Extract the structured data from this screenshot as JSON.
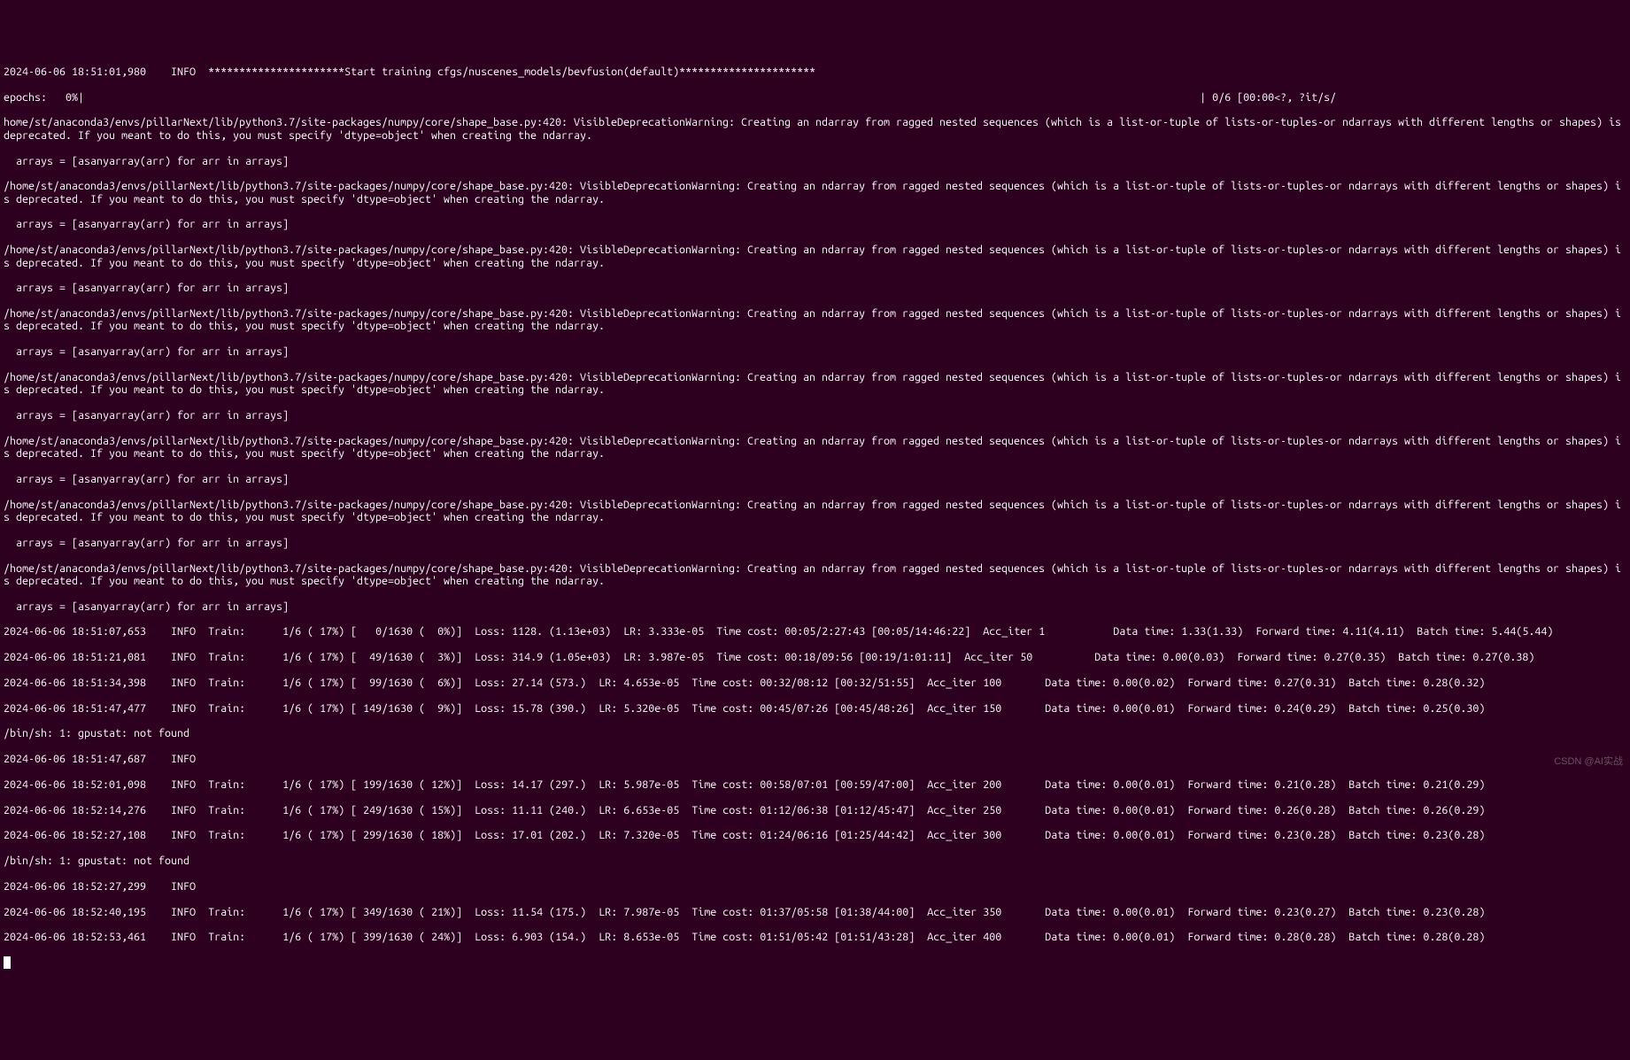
{
  "header": {
    "timestamp": "2024-06-06 18:51:01,980",
    "level": "INFO",
    "separator_left": "**********************",
    "message": "Start training cfgs/nuscenes_models/bevfusion(default)",
    "separator_right": "**********************"
  },
  "epochs_line": {
    "label": "epochs:",
    "percent": "0%",
    "progress_bar": "|",
    "counter": "| 0/6 [00:00<?, ?it/s/"
  },
  "warning_path": "home/st/anaconda3/envs/pillarNext/lib/python3.7/site-packages/numpy/core/shape_base.py:420: VisibleDeprecationWarning: Creating an ndarray from ragged nested sequences (which is a list-or-tuple of lists-or-tuples-or ndarrays with different lengths or shapes) is deprecated. If you meant to do this, you must specify 'dtype=object' when creating the ndarray.",
  "warning_path_slash": "/home/st/anaconda3/envs/pillarNext/lib/python3.7/site-packages/numpy/core/shape_base.py:420: VisibleDeprecationWarning: Creating an ndarray from ragged nested sequences (which is a list-or-tuple of lists-or-tuples-or ndarrays with different lengths or shapes) is deprecated. If you meant to do this, you must specify 'dtype=object' when creating the ndarray.",
  "arrays_line": "  arrays = [asanyarray(arr) for arr in arrays]",
  "gpustat_error": "/bin/sh: 1: gpustat: not found",
  "train_lines": [
    {
      "ts": "2024-06-06 18:51:07,653",
      "level": "INFO",
      "label": "Train:",
      "epoch": "1/6 ( 17%)",
      "iter": "[   0/1630 (  0%)]",
      "loss": "Loss: 1128. (1.13e+03)",
      "lr": "LR: 3.333e-05",
      "time_cost": "Time cost: 00:05/2:27:43 [00:05/14:46:22]",
      "acc": "Acc_iter 1",
      "data_time": "Data time: 1.33(1.33)",
      "fwd": "Forward time: 4.11(4.11)  Batch time: 5.44(5.44)",
      "wrap": true
    },
    {
      "ts": "2024-06-06 18:51:21,081",
      "level": "INFO",
      "label": "Train:",
      "epoch": "1/6 ( 17%)",
      "iter": "[  49/1630 (  3%)]",
      "loss": "Loss: 314.9 (1.05e+03)",
      "lr": "LR: 3.987e-05",
      "time_cost": "Time cost: 00:18/09:56 [00:19/1:01:11]",
      "acc": "Acc_iter 50",
      "data_time": "Data time: 0.00(0.03)",
      "fwd": "Forward time: 0.27(0.35)  Batch time: 0.27(0.38)",
      "wrap": true
    },
    {
      "ts": "2024-06-06 18:51:34,398",
      "level": "INFO",
      "label": "Train:",
      "epoch": "1/6 ( 17%)",
      "iter": "[  99/1630 (  6%)]",
      "loss": "Loss: 27.14 (573.)",
      "lr": "LR: 4.653e-05",
      "time_cost": "Time cost: 00:32/08:12 [00:32/51:55]",
      "acc": "Acc_iter 100",
      "data_time": "Data time: 0.00(0.02)",
      "fwd": "Forward time: 0.27(0.31)  Batch time: 0.28(0.32)",
      "wrap": true
    },
    {
      "ts": "2024-06-06 18:51:47,477",
      "level": "INFO",
      "label": "Train:",
      "epoch": "1/6 ( 17%)",
      "iter": "[ 149/1630 (  9%)]",
      "loss": "Loss: 15.78 (390.)",
      "lr": "LR: 5.320e-05",
      "time_cost": "Time cost: 00:45/07:26 [00:45/48:26]",
      "acc": "Acc_iter 150",
      "data_time": "Data time: 0.00(0.01)",
      "fwd": "Forward time: 0.24(0.29)  Batch time: 0.25(0.30)",
      "wrap": true
    }
  ],
  "info_empty": [
    {
      "ts": "2024-06-06 18:51:47,687",
      "level": "INFO"
    },
    {
      "ts": "2024-06-06 18:52:27,299",
      "level": "INFO"
    }
  ],
  "train_lines_2": [
    {
      "ts": "2024-06-06 18:52:01,098",
      "level": "INFO",
      "label": "Train:",
      "epoch": "1/6 ( 17%)",
      "iter": "[ 199/1630 ( 12%)]",
      "loss": "Loss: 14.17 (297.)",
      "lr": "LR: 5.987e-05",
      "time_cost": "Time cost: 00:58/07:01 [00:59/47:00]",
      "acc": "Acc_iter 200",
      "data_time": "Data time: 0.00(0.01)",
      "fwd": "Forward time: 0.21(0.28)  Batch time: 0.21(0.29)"
    },
    {
      "ts": "2024-06-06 18:52:14,276",
      "level": "INFO",
      "label": "Train:",
      "epoch": "1/6 ( 17%)",
      "iter": "[ 249/1630 ( 15%)]",
      "loss": "Loss: 11.11 (240.)",
      "lr": "LR: 6.653e-05",
      "time_cost": "Time cost: 01:12/06:38 [01:12/45:47]",
      "acc": "Acc_iter 250",
      "data_time": "Data time: 0.00(0.01)",
      "fwd": "Forward time: 0.26(0.28)  Batch time: 0.26(0.29)"
    },
    {
      "ts": "2024-06-06 18:52:27,108",
      "level": "INFO",
      "label": "Train:",
      "epoch": "1/6 ( 17%)",
      "iter": "[ 299/1630 ( 18%)]",
      "loss": "Loss: 17.01 (202.)",
      "lr": "LR: 7.320e-05",
      "time_cost": "Time cost: 01:24/06:16 [01:25/44:42]",
      "acc": "Acc_iter 300",
      "data_time": "Data time: 0.00(0.01)",
      "fwd": "Forward time: 0.23(0.28)  Batch time: 0.23(0.28)"
    }
  ],
  "train_lines_3": [
    {
      "ts": "2024-06-06 18:52:40,195",
      "level": "INFO",
      "label": "Train:",
      "epoch": "1/6 ( 17%)",
      "iter": "[ 349/1630 ( 21%)]",
      "loss": "Loss: 11.54 (175.)",
      "lr": "LR: 7.987e-05",
      "time_cost": "Time cost: 01:37/05:58 [01:38/44:00]",
      "acc": "Acc_iter 350",
      "data_time": "Data time: 0.00(0.01)",
      "fwd": "Forward time: 0.23(0.27)  Batch time: 0.23(0.28)"
    },
    {
      "ts": "2024-06-06 18:52:53,461",
      "level": "INFO",
      "label": "Train:",
      "epoch": "1/6 ( 17%)",
      "iter": "[ 399/1630 ( 24%)]",
      "loss": "Loss: 6.903 (154.)",
      "lr": "LR: 8.653e-05",
      "time_cost": "Time cost: 01:51/05:42 [01:51/43:28]",
      "acc": "Acc_iter 400",
      "data_time": "Data time: 0.00(0.01)",
      "fwd": "Forward time: 0.28(0.28)  Batch time: 0.28(0.28)"
    }
  ],
  "watermark": "CSDN @AI实战"
}
